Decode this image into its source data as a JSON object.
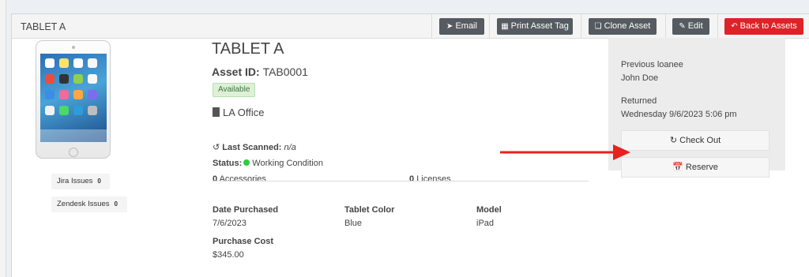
{
  "header": {
    "title": "TABLET A",
    "buttons": {
      "email": "Email",
      "print": "Print Asset Tag",
      "clone": "Clone Asset",
      "edit": "Edit",
      "back": "Back to Assets"
    }
  },
  "sidebar_tags": [
    {
      "label": "Jira Issues",
      "count": "0"
    },
    {
      "label": "Zendesk Issues",
      "count": "0"
    }
  ],
  "asset": {
    "name": "TABLET A",
    "id_label": "Asset ID:",
    "id_value": "TAB0001",
    "availability": "Available",
    "location": "LA Office",
    "last_scanned_label": "Last Scanned:",
    "last_scanned_value": "n/a",
    "status_label": "Status:",
    "status_value": "Working Condition",
    "accessories_count": "0",
    "accessories_label": "Accessories",
    "licenses_count": "0",
    "licenses_label": "Licenses"
  },
  "details": [
    {
      "label": "Date Purchased",
      "value": "7/6/2023"
    },
    {
      "label": "Tablet Color",
      "value": "Blue"
    },
    {
      "label": "Model",
      "value": "iPad"
    },
    {
      "label": "Purchase Cost",
      "value": "$345.00"
    }
  ],
  "loan": {
    "prev_label": "Previous loanee",
    "prev_value": "John Doe",
    "returned_label": "Returned",
    "returned_value": "Wednesday 9/6/2023 5:06 pm",
    "checkout_label": "Check Out",
    "reserve_label": "Reserve"
  },
  "colors": {
    "accent_red": "#dd2228",
    "button_dark": "#555b60",
    "status_green": "#2ecc40",
    "annotation_arrow": "#e8201f"
  },
  "icons": {
    "email": "paper-plane-icon",
    "print": "qr-code-icon",
    "clone": "copy-icon",
    "edit": "pencil-icon",
    "back": "reply-arrow-icon",
    "location": "building-icon",
    "last_scanned": "history-icon",
    "checkout": "sync-icon",
    "reserve": "calendar-icon"
  }
}
